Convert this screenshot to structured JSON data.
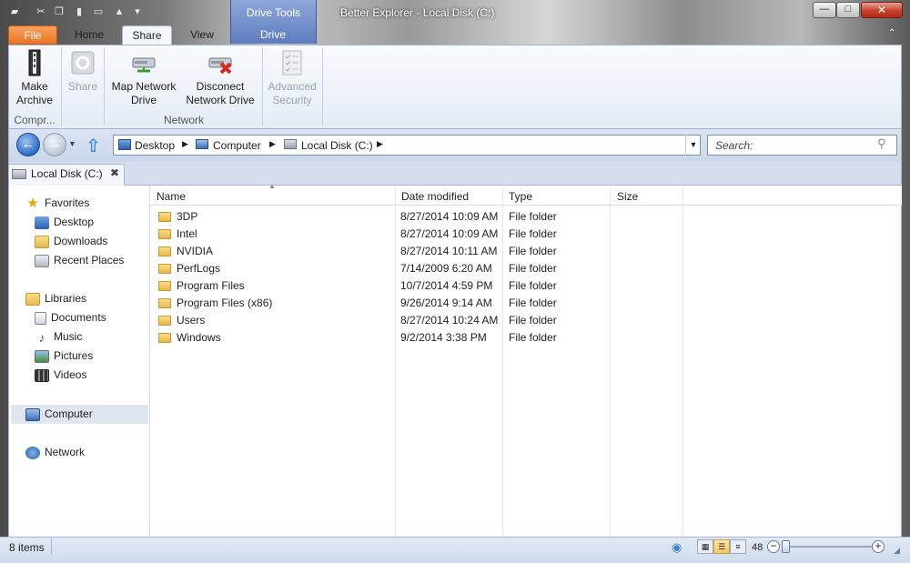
{
  "window": {
    "title": "Better Explorer - Local Disk (C:)",
    "contextual_tab_group": "Drive Tools",
    "controls": {
      "minimize": "—",
      "maximize": "□",
      "close": "✕"
    }
  },
  "ribbon": {
    "tabs": [
      {
        "label": "File"
      },
      {
        "label": "Home"
      },
      {
        "label": "Share"
      },
      {
        "label": "View"
      },
      {
        "label": "Drive"
      }
    ],
    "active_tab": "Share",
    "groups": {
      "compress": {
        "label": "Compr...",
        "make_archive": "Make\nArchive"
      },
      "share": {
        "share_btn": "Share"
      },
      "network": {
        "label": "Network",
        "map_network_drive": "Map Network\nDrive",
        "disconnect_network_drive": "Disconect\nNetwork Drive",
        "advanced_security": "Advanced\nSecurity"
      }
    }
  },
  "address_bar": {
    "crumbs": [
      "Desktop",
      "Computer",
      "Local Disk (C:)"
    ]
  },
  "search": {
    "placeholder": "Search:"
  },
  "document_tab": {
    "label": "Local Disk (C:)",
    "close": "✖"
  },
  "nav_pane": {
    "favorites": {
      "label": "Favorites",
      "items": [
        "Desktop",
        "Downloads",
        "Recent Places"
      ]
    },
    "libraries": {
      "label": "Libraries",
      "items": [
        "Documents",
        "Music",
        "Pictures",
        "Videos"
      ]
    },
    "computer": {
      "label": "Computer"
    },
    "network": {
      "label": "Network"
    }
  },
  "file_list": {
    "columns": [
      "Name",
      "Date modified",
      "Type",
      "Size"
    ],
    "rows": [
      {
        "name": "3DP",
        "date": "8/27/2014 10:09 AM",
        "type": "File folder",
        "size": ""
      },
      {
        "name": "Intel",
        "date": "8/27/2014 10:09 AM",
        "type": "File folder",
        "size": ""
      },
      {
        "name": "NVIDIA",
        "date": "8/27/2014 10:11 AM",
        "type": "File folder",
        "size": ""
      },
      {
        "name": "PerfLogs",
        "date": "7/14/2009 6:20 AM",
        "type": "File folder",
        "size": ""
      },
      {
        "name": "Program Files",
        "date": "10/7/2014 4:59 PM",
        "type": "File folder",
        "size": ""
      },
      {
        "name": "Program Files (x86)",
        "date": "9/26/2014 9:14 AM",
        "type": "File folder",
        "size": ""
      },
      {
        "name": "Users",
        "date": "8/27/2014 10:24 AM",
        "type": "File folder",
        "size": ""
      },
      {
        "name": "Windows",
        "date": "9/2/2014 3:38 PM",
        "type": "File folder",
        "size": ""
      }
    ]
  },
  "status_bar": {
    "items_count": "8 items",
    "zoom_value": "48"
  },
  "colors": {
    "file_tab": "#ec7322",
    "accent_blue": "#3f8ee0",
    "ribbon_bg": "#e5ecf6"
  }
}
